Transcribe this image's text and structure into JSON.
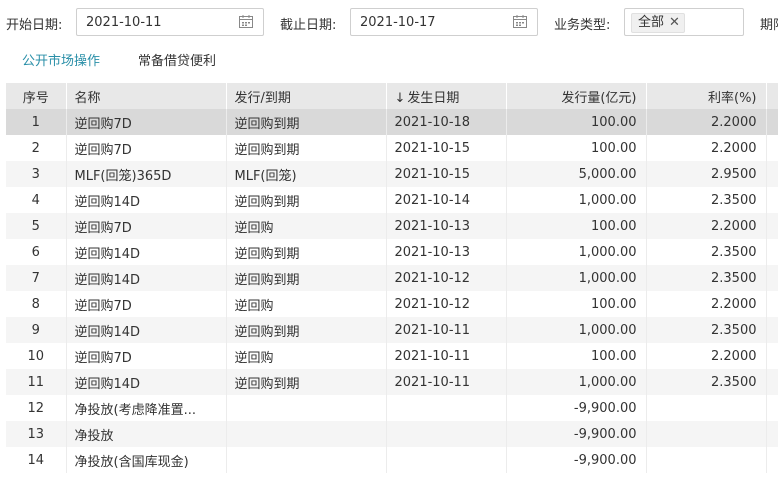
{
  "filters": {
    "start_label": "开始日期:",
    "start_value": "2021-10-11",
    "end_label": "截止日期:",
    "end_value": "2021-10-17",
    "type_label": "业务类型:",
    "type_tag": "全部",
    "extra_label": "期限"
  },
  "tabs": [
    {
      "label": "公开市场操作",
      "active": true
    },
    {
      "label": "常备借贷便利",
      "active": false
    }
  ],
  "table": {
    "columns": [
      "序号",
      "名称",
      "发行/到期",
      "发生日期",
      "发行量(亿元)",
      "利率(%)"
    ],
    "sort_indicator": "↓",
    "rows": [
      {
        "no": "1",
        "name": "逆回购7D",
        "kind": "逆回购到期",
        "date": "2021-10-18",
        "volume": "100.00",
        "rate": "2.2000"
      },
      {
        "no": "2",
        "name": "逆回购7D",
        "kind": "逆回购到期",
        "date": "2021-10-15",
        "volume": "100.00",
        "rate": "2.2000"
      },
      {
        "no": "3",
        "name": "MLF(回笼)365D",
        "kind": "MLF(回笼)",
        "date": "2021-10-15",
        "volume": "5,000.00",
        "rate": "2.9500"
      },
      {
        "no": "4",
        "name": "逆回购14D",
        "kind": "逆回购到期",
        "date": "2021-10-14",
        "volume": "1,000.00",
        "rate": "2.3500"
      },
      {
        "no": "5",
        "name": "逆回购7D",
        "kind": "逆回购",
        "date": "2021-10-13",
        "volume": "100.00",
        "rate": "2.2000"
      },
      {
        "no": "6",
        "name": "逆回购14D",
        "kind": "逆回购到期",
        "date": "2021-10-13",
        "volume": "1,000.00",
        "rate": "2.3500"
      },
      {
        "no": "7",
        "name": "逆回购14D",
        "kind": "逆回购到期",
        "date": "2021-10-12",
        "volume": "1,000.00",
        "rate": "2.3500"
      },
      {
        "no": "8",
        "name": "逆回购7D",
        "kind": "逆回购",
        "date": "2021-10-12",
        "volume": "100.00",
        "rate": "2.2000"
      },
      {
        "no": "9",
        "name": "逆回购14D",
        "kind": "逆回购到期",
        "date": "2021-10-11",
        "volume": "1,000.00",
        "rate": "2.3500"
      },
      {
        "no": "10",
        "name": "逆回购7D",
        "kind": "逆回购",
        "date": "2021-10-11",
        "volume": "100.00",
        "rate": "2.2000"
      },
      {
        "no": "11",
        "name": "逆回购14D",
        "kind": "逆回购到期",
        "date": "2021-10-11",
        "volume": "1,000.00",
        "rate": "2.3500"
      },
      {
        "no": "12",
        "name": "净投放(考虑降准置...",
        "kind": "",
        "date": "",
        "volume": "-9,900.00",
        "rate": ""
      },
      {
        "no": "13",
        "name": "净投放",
        "kind": "",
        "date": "",
        "volume": "-9,900.00",
        "rate": ""
      },
      {
        "no": "14",
        "name": "净投放(含国库现金)",
        "kind": "",
        "date": "",
        "volume": "-9,900.00",
        "rate": ""
      }
    ]
  },
  "icons": {
    "calendar": "calendar-icon",
    "close": "close-icon",
    "sort": "sort-down-icon"
  },
  "colors": {
    "active_tab": "#2a8fa8",
    "header_bg": "#e8e8e8",
    "selected_row": "#d9d9d9"
  }
}
